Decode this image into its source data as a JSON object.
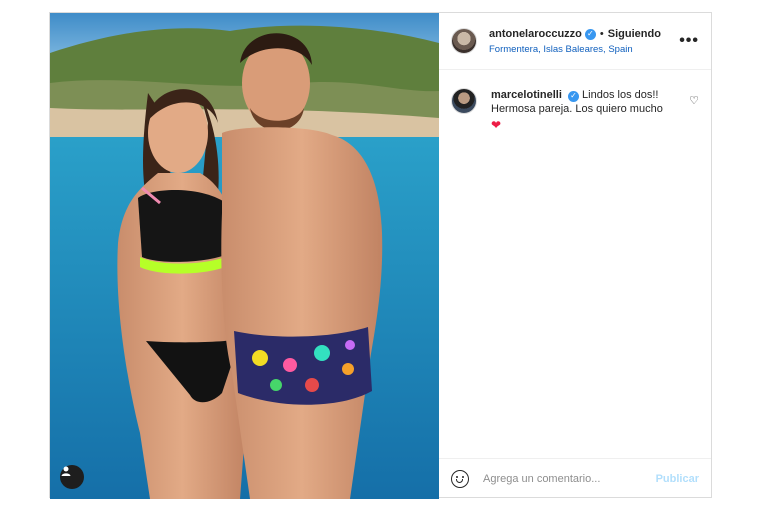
{
  "post": {
    "author": {
      "username": "antonelaroccuzzo",
      "verified": true,
      "separator": "•",
      "follow_status": "Siguiendo",
      "location": "Formentera, Islas Baleares, Spain"
    },
    "more_label": "•••",
    "comments": [
      {
        "username": "marcelotinelli",
        "verified": true,
        "text_line1": "Lindos los dos!!",
        "text_line2": "Hermosa pareja. Los quiero mucho",
        "emoji": "❤"
      }
    ],
    "comment_box": {
      "placeholder": "Agrega un comentario...",
      "publish_label": "Publicar"
    }
  },
  "colors": {
    "link": "#0f5fbd",
    "verified": "#3897f0",
    "publish_disabled": "#b2dffc",
    "sea": "#1f8fbf",
    "sky": "#5aa6d6"
  },
  "icons": [
    "verified-badge-icon",
    "more-options-icon",
    "like-heart-icon",
    "emoji-icon",
    "user-tag-icon",
    "red-heart-emoji"
  ]
}
